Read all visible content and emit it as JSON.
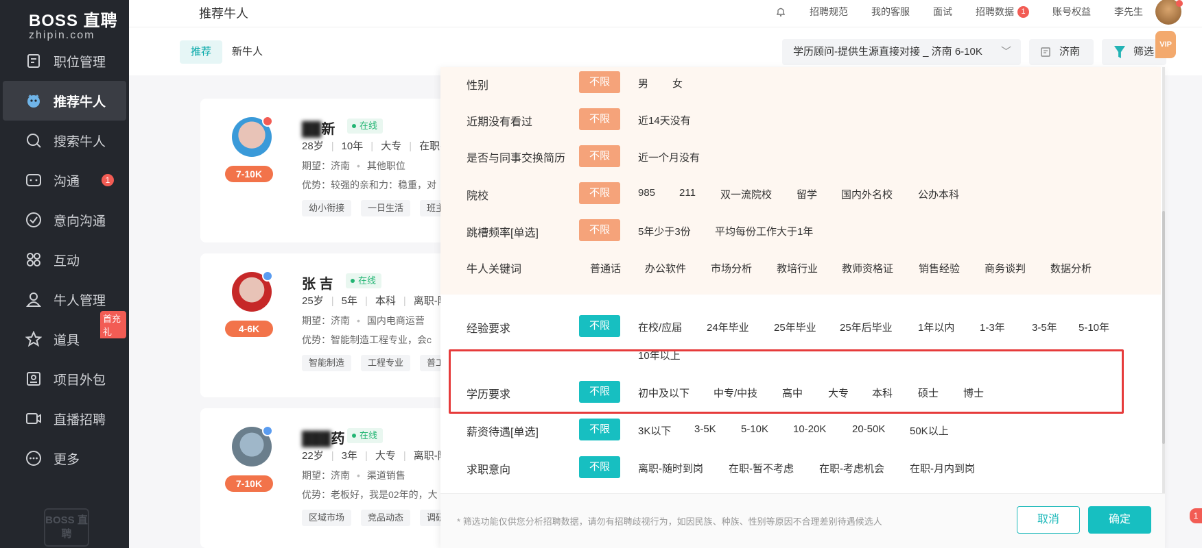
{
  "brand": {
    "name": "BOSS 直聘",
    "domain": "zhipin.com",
    "footer_logo": "BOSS 直聘"
  },
  "sidebar": {
    "items": [
      {
        "label": "职位管理",
        "icon": "document-icon"
      },
      {
        "label": "推荐牛人",
        "icon": "mascot-icon",
        "active": true
      },
      {
        "label": "搜索牛人",
        "icon": "search-icon"
      },
      {
        "label": "沟通",
        "icon": "chat-icon",
        "badge": "1"
      },
      {
        "label": "意向沟通",
        "icon": "check-circle-icon"
      },
      {
        "label": "互动",
        "icon": "grid-icon"
      },
      {
        "label": "牛人管理",
        "icon": "person-icon"
      },
      {
        "label": "道具",
        "icon": "star-icon",
        "promo": "首充礼"
      },
      {
        "label": "项目外包",
        "icon": "outsource-icon"
      },
      {
        "label": "直播招聘",
        "icon": "video-icon"
      },
      {
        "label": "更多",
        "icon": "more-icon"
      }
    ]
  },
  "header": {
    "page_title": "推荐牛人",
    "links": [
      "招聘规范",
      "我的客服",
      "面试",
      "招聘数据",
      "账号权益",
      "李先生"
    ],
    "data_badge": "1"
  },
  "subbar": {
    "tabs": [
      "推荐",
      "新牛人"
    ],
    "job_select": "学历顾问-提供生源直接对接 _ 济南 6-10K",
    "city": "济南",
    "filter": "筛选",
    "vip": "VIP"
  },
  "cards": [
    {
      "name": "新",
      "status": "在线",
      "info": [
        "28岁",
        "10年",
        "大专",
        "在职-"
      ],
      "expect_label": "期望：济南",
      "expect_job": "其他职位",
      "advantage": "优势：较强的亲和力：稳重，对",
      "tags": [
        "幼小衔接",
        "一日生活",
        "班主"
      ],
      "salary": "7-10K"
    },
    {
      "name": "张 吉",
      "status": "在线",
      "info": [
        "25岁",
        "5年",
        "本科",
        "离职-随"
      ],
      "expect_label": "期望：济南",
      "expect_job": "国内电商运营",
      "advantage": "优势：智能制造工程专业，会c",
      "tags": [
        "智能制造",
        "工程专业",
        "普工"
      ],
      "salary": "4-6K"
    },
    {
      "name": "药",
      "status": "在线",
      "info": [
        "22岁",
        "3年",
        "大专",
        "离职-随"
      ],
      "expect_label": "期望：济南",
      "expect_job": "渠道销售",
      "advantage": "优势：老板好，我是02年的，大",
      "tags": [
        "区域市场",
        "竞品动态",
        "调研"
      ],
      "salary": "7-10K"
    }
  ],
  "filters": {
    "gender": {
      "label": "性别",
      "options": [
        "不限",
        "男",
        "女"
      ]
    },
    "recent_viewed": {
      "label": "近期没有看过",
      "options": [
        "不限",
        "近14天没有"
      ]
    },
    "exchange_resume": {
      "label": "是否与同事交换简历",
      "options": [
        "不限",
        "近一个月没有"
      ]
    },
    "school": {
      "label": "院校",
      "options": [
        "不限",
        "985",
        "211",
        "双一流院校",
        "留学",
        "国内外名校",
        "公办本科"
      ]
    },
    "job_hopping": {
      "label": "跳槽频率[单选]",
      "options": [
        "不限",
        "5年少于3份",
        "平均每份工作大于1年"
      ]
    },
    "keywords": {
      "label": "牛人关键词",
      "options": [
        "普通话",
        "办公软件",
        "市场分析",
        "教培行业",
        "教师资格证",
        "销售经验",
        "商务谈判",
        "数据分析"
      ]
    },
    "experience": {
      "label": "经验要求",
      "options": [
        "不限",
        "在校/应届",
        "24年毕业",
        "25年毕业",
        "25年后毕业",
        "1年以内",
        "1-3年",
        "3-5年",
        "5-10年",
        "10年以上"
      ]
    },
    "education": {
      "label": "学历要求",
      "options": [
        "不限",
        "初中及以下",
        "中专/中技",
        "高中",
        "大专",
        "本科",
        "硕士",
        "博士"
      ]
    },
    "salary": {
      "label": "薪资待遇[单选]",
      "options": [
        "不限",
        "3K以下",
        "3-5K",
        "5-10K",
        "10-20K",
        "20-50K",
        "50K以上"
      ]
    },
    "job_intent": {
      "label": "求职意向",
      "options": [
        "不限",
        "离职-随时到岗",
        "在职-暂不考虑",
        "在职-考虑机会",
        "在职-月内到岗"
      ]
    }
  },
  "footer": {
    "disclaimer": "* 筛选功能仅供您分析招聘数据，请勿有招聘歧视行为，如因民族、种族、性别等原因不合理差别待遇候选人",
    "cancel": "取消",
    "confirm": "确定",
    "corner_badge": "1"
  },
  "colors": {
    "teal": "#17bfc1",
    "orange_selected": "#f5a37a",
    "salary_badge": "#f2734a",
    "highlight": "#e63b3b",
    "sidebar_bg": "#24272d"
  }
}
